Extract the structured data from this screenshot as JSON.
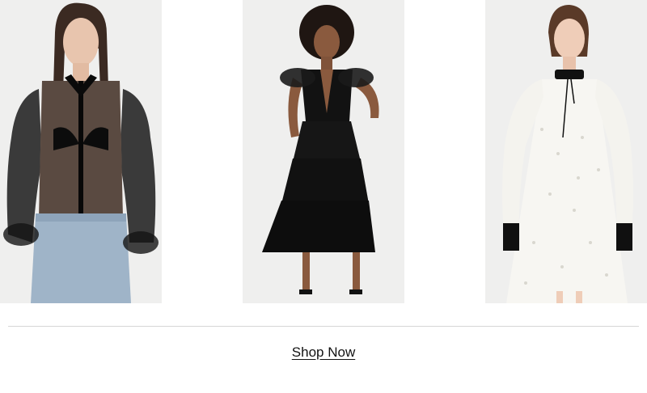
{
  "products": [
    {
      "icon": "sheer-black-blouse-model-image"
    },
    {
      "icon": "black-tiered-ruffle-dress-model-image"
    },
    {
      "icon": "white-eyelet-dress-model-image"
    }
  ],
  "cta": {
    "label": "Shop Now"
  },
  "colors": {
    "tile_background": "#efefee",
    "text": "#111111",
    "divider": "#d6d6d6"
  }
}
